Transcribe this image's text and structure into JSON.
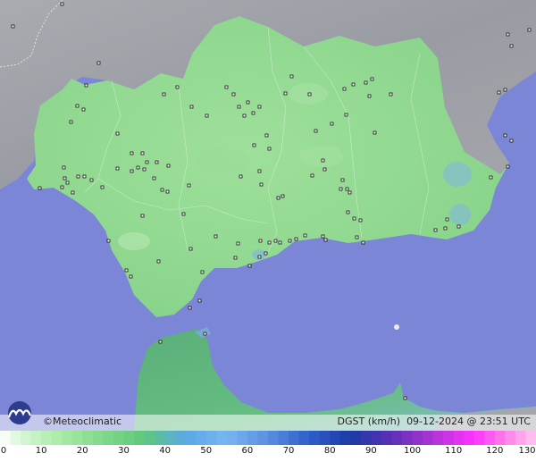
{
  "brand": {
    "copyright_symbol": "©",
    "name": "Meteoclimatic",
    "logo_icon": "meteoclimatic-logo"
  },
  "meta": {
    "variable": "DGST (km/h)",
    "datetime": "09-12-2024 @ 23:51 UTC"
  },
  "legend": {
    "ticks": [
      "0",
      "10",
      "20",
      "30",
      "40",
      "50",
      "60",
      "70",
      "80",
      "90",
      "100",
      "110",
      "120",
      "130"
    ],
    "min": 0,
    "max": 130,
    "unit": "km/h"
  },
  "colors": {
    "sea": "#7b86d6",
    "land_outside": "#9ea0a6",
    "andalusia": "#8fd88f",
    "morocco": "#5fb77a"
  }
}
